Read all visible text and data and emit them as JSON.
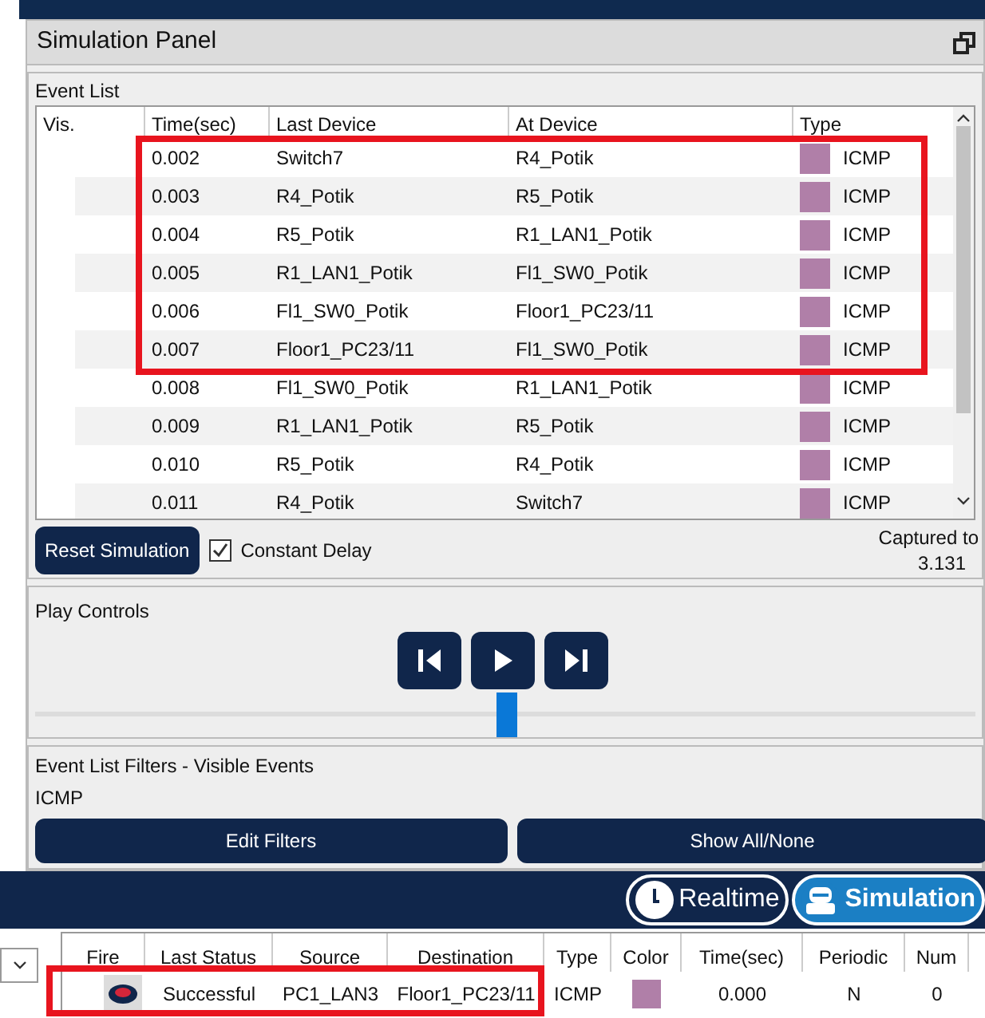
{
  "panel": {
    "title": "Simulation Panel"
  },
  "event_list": {
    "title": "Event List",
    "columns": [
      "Vis.",
      "Time(sec)",
      "Last Device",
      "At Device",
      "Type"
    ],
    "groups": [
      {
        "highlighted": true,
        "rows": [
          {
            "time": "0.002",
            "last_device": "Switch7",
            "at_device": "R4_Potik",
            "type": "ICMP"
          },
          {
            "time": "0.003",
            "last_device": "R4_Potik",
            "at_device": "R5_Potik",
            "type": "ICMP"
          },
          {
            "time": "0.004",
            "last_device": "R5_Potik",
            "at_device": "R1_LAN1_Potik",
            "type": "ICMP"
          },
          {
            "time": "0.005",
            "last_device": "R1_LAN1_Potik",
            "at_device": "Fl1_SW0_Potik",
            "type": "ICMP"
          },
          {
            "time": "0.006",
            "last_device": "Fl1_SW0_Potik",
            "at_device": "Floor1_PC23/11",
            "type": "ICMP"
          },
          {
            "time": "0.007",
            "last_device": "Floor1_PC23/11",
            "at_device": "Fl1_SW0_Potik",
            "type": "ICMP"
          }
        ]
      },
      {
        "highlighted": false,
        "rows": [
          {
            "time": "0.008",
            "last_device": "Fl1_SW0_Potik",
            "at_device": "R1_LAN1_Potik",
            "type": "ICMP"
          },
          {
            "time": "0.009",
            "last_device": "R1_LAN1_Potik",
            "at_device": "R5_Potik",
            "type": "ICMP"
          },
          {
            "time": "0.010",
            "last_device": "R5_Potik",
            "at_device": "R4_Potik",
            "type": "ICMP"
          },
          {
            "time": "0.011",
            "last_device": "R4_Potik",
            "at_device": "Switch7",
            "type": "ICMP"
          }
        ]
      }
    ],
    "reset_button": "Reset Simulation",
    "constant_delay": {
      "label": "Constant Delay",
      "checked": true
    },
    "captured_label": "Captured to",
    "captured_value": "3.131"
  },
  "play_controls": {
    "title": "Play Controls",
    "level": 0.5
  },
  "filters": {
    "title": "Event List Filters - Visible Events",
    "visible": "ICMP",
    "buttons": [
      "Edit Filters",
      "Show All/None"
    ]
  },
  "modes": [
    {
      "label": "Realtime",
      "kind": "clock",
      "selected": false
    },
    {
      "label": "Simulation",
      "kind": "sim",
      "selected": true
    }
  ],
  "pdu_list": {
    "columns": [
      "Fire",
      "Last Status",
      "Source",
      "Destination",
      "Type",
      "Color",
      "Time(sec)",
      "Periodic",
      "Num"
    ],
    "rows": [
      {
        "last_status": "Successful",
        "source": "PC1_LAN3",
        "destination": "Floor1_PC23/11",
        "type": "ICMP",
        "color": "#b07fa8",
        "time": "0.000",
        "periodic": "N",
        "num": "0",
        "highlighted": true
      }
    ]
  }
}
